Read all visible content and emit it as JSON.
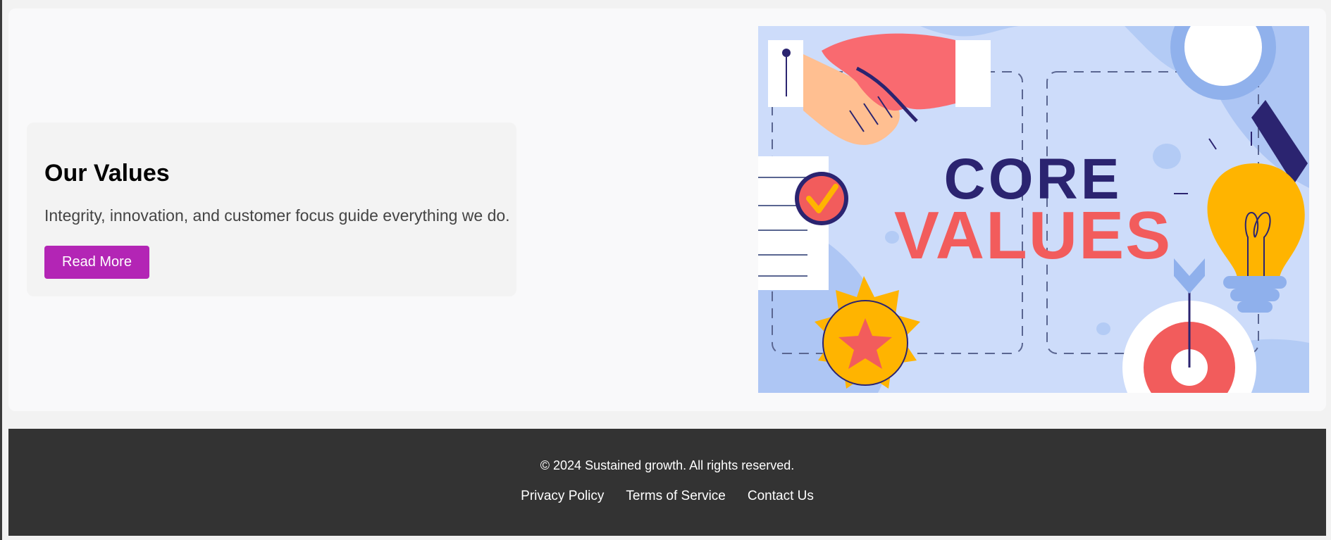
{
  "values": {
    "title": "Our Values",
    "text": "Integrity, innovation, and customer focus guide everything we do.",
    "button_label": "Read More"
  },
  "hero_image": {
    "line1": "CORE",
    "line2": "VALUES"
  },
  "footer": {
    "copyright": "© 2024 Sustained growth. All rights reserved.",
    "links": [
      "Privacy Policy",
      "Terms of Service",
      "Contact Us"
    ]
  },
  "colors": {
    "button": "#b325b5",
    "footer_bg": "#333333",
    "image_bg": "#cddcfa",
    "core_text": "#2b2470",
    "values_text": "#f25c5c"
  }
}
